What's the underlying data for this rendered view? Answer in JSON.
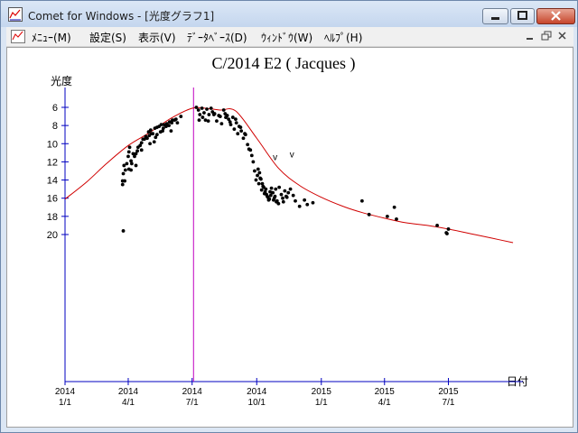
{
  "window": {
    "title": "Comet for Windows - [光度グラフ1]",
    "icons": {
      "app": "chart-app-icon",
      "minimize": "minimize-icon",
      "maximize": "maximize-icon",
      "close": "close-icon"
    }
  },
  "menu": {
    "items": [
      "ﾒﾆｭｰ(M)",
      "設定(S)",
      "表示(V)",
      "ﾃﾞｰﾀﾍﾞｰｽ(D)",
      "ｳｨﾝﾄﾞｳ(W)",
      "ﾍﾙﾌﾟ(H)"
    ],
    "mdi_icons": {
      "document": "chart-document-icon",
      "minimize": "mdi-minimize-icon",
      "restore": "mdi-restore-icon",
      "close": "mdi-close-icon"
    }
  },
  "chart_data": {
    "type": "scatter",
    "title": "C/2014 E2 ( Jacques )",
    "ylabel": "光度",
    "xlabel": "日付",
    "y_reversed": true,
    "ylim": [
      21,
      5
    ],
    "yticks": [
      6,
      8,
      10,
      12,
      14,
      16,
      18,
      20
    ],
    "xlim": [
      "2014-01-01",
      "2015-10-15"
    ],
    "xticks": [
      {
        "x": "2014-01-01",
        "label": [
          "2014",
          "1/1"
        ]
      },
      {
        "x": "2014-04-01",
        "label": [
          "2014",
          "4/1"
        ]
      },
      {
        "x": "2014-07-01",
        "label": [
          "2014",
          "7/1"
        ]
      },
      {
        "x": "2014-10-01",
        "label": [
          "2014",
          "10/1"
        ]
      },
      {
        "x": "2015-01-01",
        "label": [
          "2015",
          "1/1"
        ]
      },
      {
        "x": "2015-04-01",
        "label": [
          "2015",
          "4/1"
        ]
      },
      {
        "x": "2015-07-01",
        "label": [
          "2015",
          "7/1"
        ]
      }
    ],
    "perihelion_line": {
      "x": "2014-07-03",
      "color": "#c000c0"
    },
    "axis_color": "#0000c0",
    "curve_color": "#d00000",
    "curve": {
      "x": [
        "2014-01-01",
        "2014-02-01",
        "2014-03-01",
        "2014-04-01",
        "2014-05-01",
        "2014-06-01",
        "2014-07-01",
        "2014-07-20",
        "2014-08-10",
        "2014-09-01",
        "2014-10-01",
        "2014-11-01",
        "2014-12-01",
        "2015-01-01",
        "2015-02-01",
        "2015-03-01",
        "2015-04-01",
        "2015-05-01",
        "2015-06-01",
        "2015-07-01",
        "2015-08-01",
        "2015-09-01",
        "2015-10-01"
      ],
      "y": [
        16.1,
        14.2,
        12.2,
        10.2,
        8.8,
        7.2,
        6.1,
        6.1,
        6.3,
        6.4,
        9.4,
        12.7,
        14.6,
        15.9,
        16.9,
        17.6,
        18.2,
        18.7,
        19.0,
        19.4,
        19.9,
        20.4,
        20.9
      ]
    },
    "observations": {
      "x": [
        "2014-03-24",
        "2014-03-24",
        "2014-03-25",
        "2014-03-26",
        "2014-03-28",
        "2014-03-30",
        "2014-04-01",
        "2014-04-02",
        "2014-04-03",
        "2014-04-05",
        "2014-04-08",
        "2014-04-12",
        "2014-04-15",
        "2014-04-20",
        "2014-04-24",
        "2014-04-28",
        "2014-05-01",
        "2014-05-04",
        "2014-05-06",
        "2014-05-09",
        "2014-05-12",
        "2014-05-15",
        "2014-05-18",
        "2014-05-22",
        "2014-05-26",
        "2014-05-30",
        "2014-06-03",
        "2014-06-08",
        "2014-06-15",
        "2014-04-02",
        "2014-04-06",
        "2014-04-10",
        "2014-04-14",
        "2014-04-18",
        "2014-04-22",
        "2014-04-26",
        "2014-04-30",
        "2014-05-03",
        "2014-05-08",
        "2014-05-12",
        "2014-05-17",
        "2014-05-21",
        "2014-05-25",
        "2014-05-29",
        "2014-06-02",
        "2014-06-06",
        "2014-07-07",
        "2014-07-10",
        "2014-07-12",
        "2014-07-15",
        "2014-07-18",
        "2014-07-20",
        "2014-07-22",
        "2014-07-25",
        "2014-07-28",
        "2014-07-30",
        "2014-08-02",
        "2014-08-05",
        "2014-08-08",
        "2014-08-12",
        "2014-08-15",
        "2014-08-18",
        "2014-08-20",
        "2014-08-22",
        "2014-08-25",
        "2014-08-28",
        "2014-08-30",
        "2014-09-02",
        "2014-09-04",
        "2014-09-06",
        "2014-09-09",
        "2014-09-12",
        "2014-09-15",
        "2014-07-11",
        "2014-07-16",
        "2014-07-24",
        "2014-08-01",
        "2014-08-10",
        "2014-08-17",
        "2014-08-24",
        "2014-09-01",
        "2014-09-08",
        "2014-09-14",
        "2014-09-18",
        "2014-09-20",
        "2014-09-22",
        "2014-09-24",
        "2014-09-26",
        "2014-09-28",
        "2014-09-30",
        "2014-10-02",
        "2014-10-04",
        "2014-10-06",
        "2014-10-08",
        "2014-10-10",
        "2014-10-12",
        "2014-10-14",
        "2014-10-16",
        "2014-10-18",
        "2014-10-20",
        "2014-10-22",
        "2014-10-24",
        "2014-10-26",
        "2014-10-28",
        "2014-10-30",
        "2014-11-02",
        "2014-11-05",
        "2014-11-08",
        "2014-11-10",
        "2014-11-13",
        "2014-10-03",
        "2014-10-05",
        "2014-10-07",
        "2014-10-09",
        "2014-10-11",
        "2014-10-13",
        "2014-10-15",
        "2014-10-17",
        "2014-10-19",
        "2014-10-21",
        "2014-10-23",
        "2014-10-25",
        "2014-10-27",
        "2014-10-29",
        "2014-11-01",
        "2014-11-07",
        "2014-11-12",
        "2014-11-15",
        "2014-11-18",
        "2014-11-22",
        "2014-11-25",
        "2014-12-01",
        "2014-12-08",
        "2014-12-12",
        "2014-12-20",
        "2015-02-28",
        "2015-03-10",
        "2015-04-05",
        "2015-04-15",
        "2015-04-18",
        "2015-06-15",
        "2015-06-28",
        "2015-07-01",
        "2015-06-29",
        "2014-03-25",
        "2014-03-27",
        "2014-04-05",
        "2014-04-12",
        "2014-04-20",
        "2014-05-02",
        "2014-05-10",
        "2014-05-20",
        "2014-06-01",
        "2014-06-10"
      ],
      "y": [
        14.5,
        14.1,
        13.3,
        12.4,
        12.9,
        12.2,
        11.4,
        10.9,
        10.4,
        11.9,
        11.1,
        12.4,
        10.4,
        9.9,
        9.5,
        9.4,
        9.1,
        8.9,
        8.9,
        8.3,
        8.2,
        8.1,
        7.9,
        7.9,
        7.8,
        7.6,
        7.4,
        7.3,
        7.0,
        12.8,
        12.2,
        11.4,
        10.8,
        10.2,
        9.5,
        9.2,
        8.7,
        8.5,
        9.8,
        9.0,
        8.7,
        8.3,
        8.1,
        8.0,
        7.7,
        7.4,
        6.0,
        6.3,
        6.8,
        6.1,
        6.6,
        7.4,
        6.2,
        6.8,
        6.1,
        6.5,
        6.7,
        7.5,
        6.9,
        7.8,
        6.3,
        7.1,
        6.9,
        7.3,
        7.9,
        7.1,
        8.4,
        7.7,
        8.9,
        8.1,
        8.6,
        9.4,
        9.0,
        7.4,
        7.1,
        7.5,
        6.8,
        7.0,
        6.7,
        7.6,
        7.3,
        8.2,
        8.9,
        10.1,
        10.6,
        10.7,
        11.3,
        12.0,
        13.0,
        14.0,
        13.5,
        14.4,
        13.8,
        15.1,
        14.7,
        15.5,
        15.0,
        15.8,
        16.2,
        15.3,
        14.9,
        15.4,
        16.0,
        15.0,
        16.3,
        14.8,
        15.6,
        16.4,
        15.2,
        15.9,
        12.8,
        13.2,
        13.9,
        14.4,
        14.8,
        15.3,
        15.6,
        15.9,
        16.1,
        15.7,
        15.4,
        16.2,
        15.8,
        16.4,
        16.6,
        16.0,
        15.8,
        15.4,
        15.0,
        15.7,
        16.3,
        16.9,
        16.2,
        16.7,
        16.5,
        16.3,
        17.8,
        18.0,
        17.0,
        18.3,
        19.0,
        19.8,
        19.4,
        19.9,
        19.6,
        14.1,
        12.9,
        11.1,
        10.7,
        10.0,
        9.3,
        8.6,
        8.6,
        7.7,
        7.6
      ]
    },
    "marker_labels": [
      {
        "x": "2014-10-24",
        "y": 11.8,
        "text": "v"
      },
      {
        "x": "2014-11-17",
        "y": 11.5,
        "text": "v"
      }
    ]
  }
}
